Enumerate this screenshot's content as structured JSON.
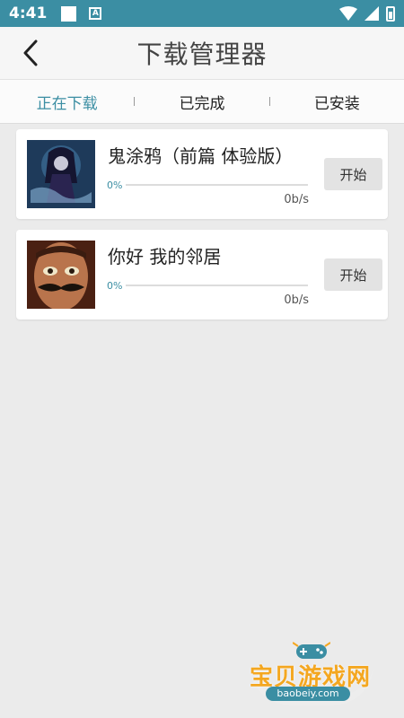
{
  "status_bar": {
    "time": "4:41",
    "letter_icon": "A",
    "bg_color": "#3b8ea3"
  },
  "header": {
    "title": "下载管理器",
    "back_icon": "chevron-left-icon"
  },
  "tabs": [
    {
      "label": "正在下载",
      "active": true
    },
    {
      "label": "已完成",
      "active": false
    },
    {
      "label": "已安装",
      "active": false
    }
  ],
  "downloads": [
    {
      "name": "鬼涂鸦（前篇 体验版）",
      "progress": "0%",
      "speed": "0b/s",
      "button": "开始",
      "thumb_icon": "ghost-doodle-thumbnail"
    },
    {
      "name": "你好 我的邻居",
      "progress": "0%",
      "speed": "0b/s",
      "button": "开始",
      "thumb_icon": "hello-neighbor-thumbnail"
    }
  ],
  "watermark": {
    "main": "宝贝游戏网",
    "sub": "baobeiy.com"
  },
  "colors": {
    "accent": "#3b8ea3",
    "watermark": "#f4a720"
  }
}
